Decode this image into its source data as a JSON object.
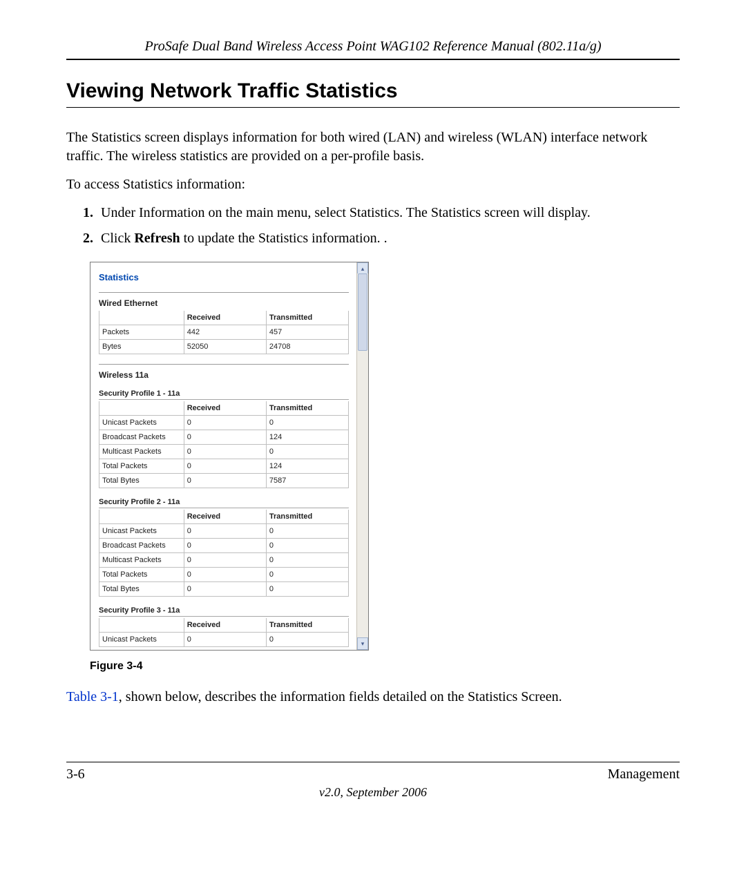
{
  "header": {
    "running_head": "ProSafe Dual Band Wireless Access Point WAG102 Reference Manual (802.11a/g)"
  },
  "section": {
    "title": "Viewing Network Traffic Statistics",
    "para1": "The Statistics screen displays information for both wired (LAN) and wireless (WLAN) interface network traffic. The wireless statistics are provided on a per-profile basis.",
    "para2": "To access Statistics information:",
    "step1": "Under Information on the main menu, select Statistics. The Statistics screen will display.",
    "step2_pre": "Click ",
    "step2_bold": "Refresh",
    "step2_post": " to update the Statistics information. ."
  },
  "figure": {
    "caption": "Figure 3-4",
    "panel_title": "Statistics",
    "columns": {
      "blank": "",
      "received": "Received",
      "transmitted": "Transmitted"
    },
    "wired": {
      "heading": "Wired Ethernet",
      "rows": [
        {
          "label": "Packets",
          "rx": "442",
          "tx": "457"
        },
        {
          "label": "Bytes",
          "rx": "52050",
          "tx": "24708"
        }
      ]
    },
    "wireless_heading": "Wireless 11a",
    "profiles": [
      {
        "heading": "Security Profile 1 - 11a",
        "rows": [
          {
            "label": "Unicast Packets",
            "rx": "0",
            "tx": "0"
          },
          {
            "label": "Broadcast Packets",
            "rx": "0",
            "tx": "124"
          },
          {
            "label": "Multicast Packets",
            "rx": "0",
            "tx": "0"
          },
          {
            "label": "Total Packets",
            "rx": "0",
            "tx": "124"
          },
          {
            "label": "Total Bytes",
            "rx": "0",
            "tx": "7587"
          }
        ]
      },
      {
        "heading": "Security Profile 2 - 11a",
        "rows": [
          {
            "label": "Unicast Packets",
            "rx": "0",
            "tx": "0"
          },
          {
            "label": "Broadcast Packets",
            "rx": "0",
            "tx": "0"
          },
          {
            "label": "Multicast Packets",
            "rx": "0",
            "tx": "0"
          },
          {
            "label": "Total Packets",
            "rx": "0",
            "tx": "0"
          },
          {
            "label": "Total Bytes",
            "rx": "0",
            "tx": "0"
          }
        ]
      },
      {
        "heading": "Security Profile 3 - 11a",
        "rows": [
          {
            "label": "Unicast Packets",
            "rx": "0",
            "tx": "0"
          }
        ]
      }
    ]
  },
  "after_figure": {
    "link_text": "Table 3-1",
    "rest": ", shown below, describes the information fields detailed on the Statistics Screen."
  },
  "footer": {
    "left": "3-6",
    "right": "Management",
    "version": "v2.0, September 2006"
  }
}
